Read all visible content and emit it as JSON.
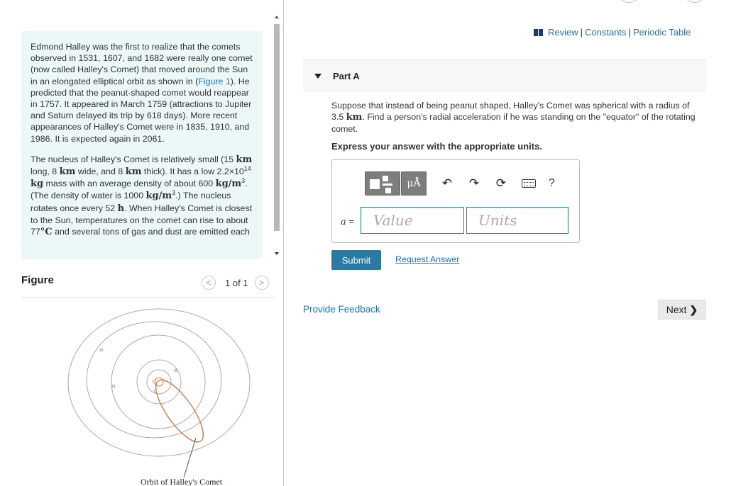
{
  "intro": {
    "p1_text": "Edmond Halley was the first to realize that the comets observed in 1531, 1607, and 1682 were really one comet (now called Halley's Comet) that moved around the Sun in an elongated elliptical orbit as shown in (",
    "p1_link": "Figure 1",
    "p1_rest": "). He predicted that the peanut-shaped comet would reappear in 1757. It appeared in March 1759 (attractions to Jupiter and Saturn delayed its trip by 618 days). More recent appearances of Halley's Comet were in 1835, 1910, and 1986. It is expected again in 2061.",
    "p2": {
      "a": "The nucleus of Halley's Comet is relatively small (15 ",
      "u_km1": "km",
      "b": " long, 8 ",
      "u_km2": "km",
      "c": " wide, and 8 ",
      "u_km3": "km",
      "d": " thick). It has a low 2.2×10",
      "exp14": "14",
      "u_kg": " kg",
      "e": " mass with an average density of about 600 ",
      "u_kgm3a": "kg/m",
      "exp3a": "3",
      "f": ". (The density of water is 1000 ",
      "u_kgm3b": "kg/m",
      "exp3b": "3",
      "g": ".) The nucleus rotates once every 52 ",
      "u_h": "h",
      "h": ". When Halley's Comet is closest to the Sun, temperatures on the comet can rise to about 77",
      "u_degc": "°C",
      "i": " and several tons of gas and dust are emitted each"
    }
  },
  "figure": {
    "title": "Figure",
    "pager": "1 of 1",
    "prev": "<",
    "next": ">",
    "caption": "Orbit of Halley's Comet"
  },
  "header": {
    "review": "Review",
    "constants": "Constants",
    "periodic": "Periodic Table",
    "separator": "|"
  },
  "part": {
    "title": "Part A",
    "question_a": "Suppose that instead of being peanut shaped, Halley's Comet was spherical with a radius of 3.5 ",
    "question_unit": "km",
    "question_b": ". Find a person's radial acceleration if he was standing on the \"equator\" of the rotating comet.",
    "instruction": "Express your answer with the appropriate units."
  },
  "answer": {
    "mu_label": "μÅ",
    "help": "?",
    "var_symbol": "a",
    "var_equals": " =",
    "value_placeholder": "Value",
    "units_placeholder": "Units"
  },
  "actions": {
    "submit": "Submit",
    "request": "Request Answer",
    "feedback": "Provide Feedback",
    "next": "Next",
    "next_chevron": "❯"
  },
  "icons": {
    "undo": "↶",
    "redo": "↷",
    "reset": "⟳"
  },
  "colors": {
    "link": "#1c74c4",
    "submit": "#2a7aa6",
    "intro_bg": "#ecf8f8",
    "orbit_comet": "#e07030"
  }
}
